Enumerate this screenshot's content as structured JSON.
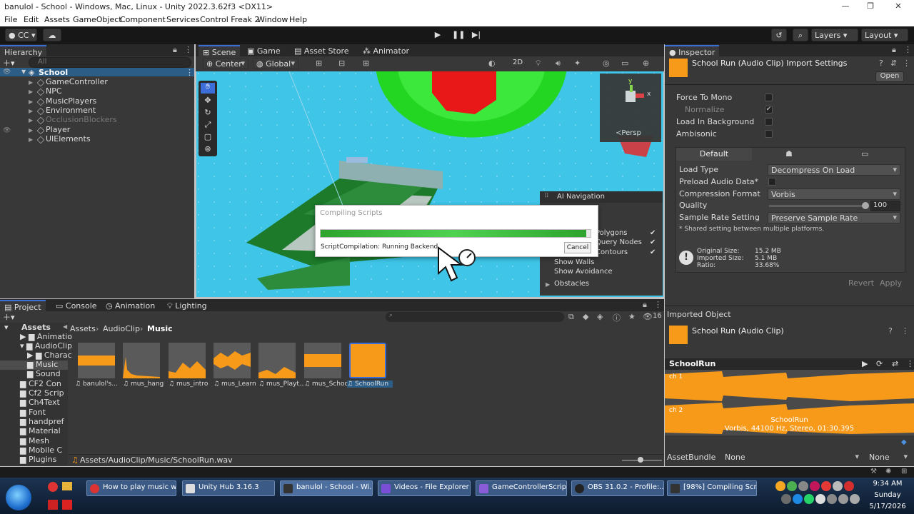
{
  "window": {
    "title": "banulol - School - Windows, Mac, Linux - Unity 2022.3.62f3 <DX11>"
  },
  "menu": [
    "File",
    "Edit",
    "Assets",
    "GameObject",
    "Component",
    "Services",
    "Control Freak 2",
    "Window",
    "Help"
  ],
  "toolbar": {
    "account": "CC",
    "layers": "Layers",
    "layout": "Layout"
  },
  "hierarchy": {
    "tab": "Hierarchy",
    "search_placeholder": "All",
    "scene": "School",
    "items": [
      "GameController",
      "NPC",
      "MusicPlayers",
      "Environment",
      "OcclusionBlockers",
      "Player",
      "UIElements"
    ]
  },
  "scene_tabs": [
    "Scene",
    "Game",
    "Asset Store",
    "Animator"
  ],
  "scene_toolbar": {
    "pivot": "Center",
    "space": "Global",
    "mode2d": "2D"
  },
  "gizmo": {
    "label": "Persp",
    "x": "x",
    "y": "y"
  },
  "ai_nav": {
    "title": "AI Navigation",
    "items": [
      "Polygons",
      "Query Nodes",
      "Contours",
      "Show Walls",
      "Show Avoidance",
      "Obstacles"
    ]
  },
  "compile": {
    "title": "Compiling Scripts",
    "status": "ScriptCompilation: Running Backend",
    "cancel": "Cancel",
    "progress": 0.98
  },
  "inspector": {
    "tab": "Inspector",
    "title": "School Run (Audio Clip) Import Settings",
    "open": "Open",
    "force_to_mono": "Force To Mono",
    "normalize": "Normalize",
    "load_in_background": "Load In Background",
    "ambisonic": "Ambisonic",
    "platform_default": "Default",
    "load_type_label": "Load Type",
    "load_type": "Decompress On Load",
    "preload_label": "Preload Audio Data*",
    "compression_label": "Compression Format",
    "compression": "Vorbis",
    "quality_label": "Quality",
    "quality": "100",
    "quality_value": 1.0,
    "sample_rate_label": "Sample Rate Setting",
    "sample_rate": "Preserve Sample Rate",
    "shared_note": "* Shared setting between multiple platforms.",
    "original_size": "Original Size:",
    "original_size_val": "15.2 MB",
    "imported_size": "Imported Size:",
    "imported_size_val": "5.1 MB",
    "ratio": "Ratio:",
    "ratio_val": "33.68%",
    "revert": "Revert",
    "apply": "Apply",
    "imported_object": "Imported Object",
    "imported_name": "School Run (Audio Clip)",
    "preview_title": "SchoolRun",
    "ch1": "ch 1",
    "ch2": "ch 2",
    "preview_name": "SchoolRun",
    "preview_info": "Vorbis, 44100 Hz, Stereo, 01:30.395",
    "asset_bundle": "AssetBundle",
    "bundle_value": "None",
    "variant_value": "None"
  },
  "project": {
    "tabs": [
      "Project",
      "Console",
      "Animation",
      "Lighting"
    ],
    "count": "16",
    "breadcrumb": [
      "Assets",
      "AudioClip",
      "Music"
    ],
    "tree": [
      "Assets",
      "Animatio",
      "AudioClip",
      "Charac",
      "Music",
      "Sound",
      "CF2 Con",
      "Cf2 Scrip",
      "Ch4Text",
      "Font",
      "handpref",
      "Material",
      "Mesh",
      "Mobile C",
      "Plugins"
    ],
    "assets": [
      "banulol's...",
      "mus_hang",
      "mus_intro",
      "mus_Learn",
      "mus_Playt...",
      "mus_School",
      "SchoolRun"
    ],
    "path": "Assets/AudioClip/Music/SchoolRun.wav"
  },
  "taskbar": {
    "items": [
      "How to play music w...",
      "Unity Hub 3.16.3",
      "banulol - School - Wi...",
      "Videos - File Explorer",
      "GameControllerScrip...",
      "OBS 31.0.2 - Profile:...",
      "[98%] Compiling Scri..."
    ],
    "time": "9:34 AM",
    "day": "Sunday",
    "date": "5/17/2026"
  },
  "colors": {
    "accent": "#3b6ed8",
    "orange": "#f79a1a",
    "waveform": "#f79a1a",
    "sky": "#3ec5e8",
    "progress": "#2ea32e"
  }
}
